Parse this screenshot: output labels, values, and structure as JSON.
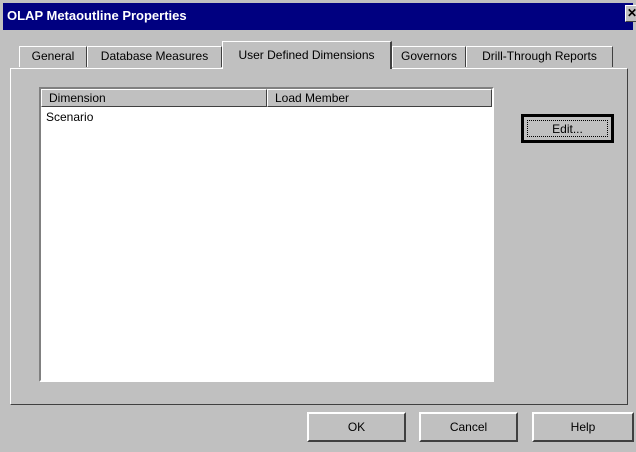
{
  "window": {
    "title": "OLAP Metaoutline Properties",
    "close_glyph": "✕"
  },
  "tabs": [
    {
      "label": "General",
      "active": false
    },
    {
      "label": "Database Measures",
      "active": false
    },
    {
      "label": "User Defined Dimensions",
      "active": true
    },
    {
      "label": "Governors",
      "active": false
    },
    {
      "label": "Drill-Through Reports",
      "active": false
    }
  ],
  "list": {
    "columns": [
      "Dimension",
      "Load Member"
    ],
    "rows": [
      {
        "dimension": "Scenario",
        "load_member": ""
      }
    ]
  },
  "buttons": {
    "edit": "Edit...",
    "ok": "OK",
    "cancel": "Cancel",
    "help": "Help"
  }
}
